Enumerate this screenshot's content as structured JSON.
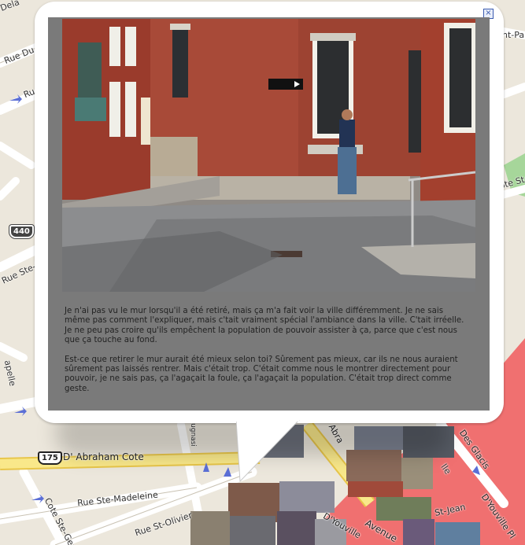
{
  "map": {
    "streets": [
      "Rue Du P",
      "Rue Ste-Ma",
      "Ru",
      "apelle",
      "D' Abraham Cote",
      "Rue Ste-Madeleine",
      "Rue St-Olivier",
      "Cote Ste-Gen",
      "Dela",
      "nt-Pa",
      "ote Ste",
      "Des Glacis",
      "D'Youville Pl",
      "St-Jean",
      "Avenue",
      "D'Youville",
      "Abra",
      "lle",
      "ugnasi"
    ],
    "shields": [
      "440",
      "175"
    ],
    "colors": {
      "bg": "#ece7dc",
      "road": "#ffffff",
      "highway": "#f9e88a",
      "red_zone": "#f07070",
      "park": "#a6d69a"
    }
  },
  "popup": {
    "close_icon": "close-icon",
    "photo_alt": "Homme à la fenêtre d'une maison en briques, rue en pente",
    "paragraphs": [
      "Je n'ai pas vu le mur lorsqu'il a été retiré, mais ça m'a fait voir la ville différemment. Je ne sais même pas comment l'expliquer, mais c'tait vraiment spécial l'ambiance dans la ville. C'tait irréelle. Je ne peu pas croire qu'ils empêchent la population de pouvoir assister à ça, parce que c'est nous que ça touche au fond.",
      "Est-ce que retirer le mur aurait été mieux selon toi? Sûrement pas mieux, car ils ne nous auraient sûrement pas laissés rentrer. Mais c'était trop. C'était comme nous le montrer directement pour pouvoir, je ne sais pas, ça l'agaçait la foule, ça l'agaçait la population. C'était trop direct comme geste."
    ]
  }
}
